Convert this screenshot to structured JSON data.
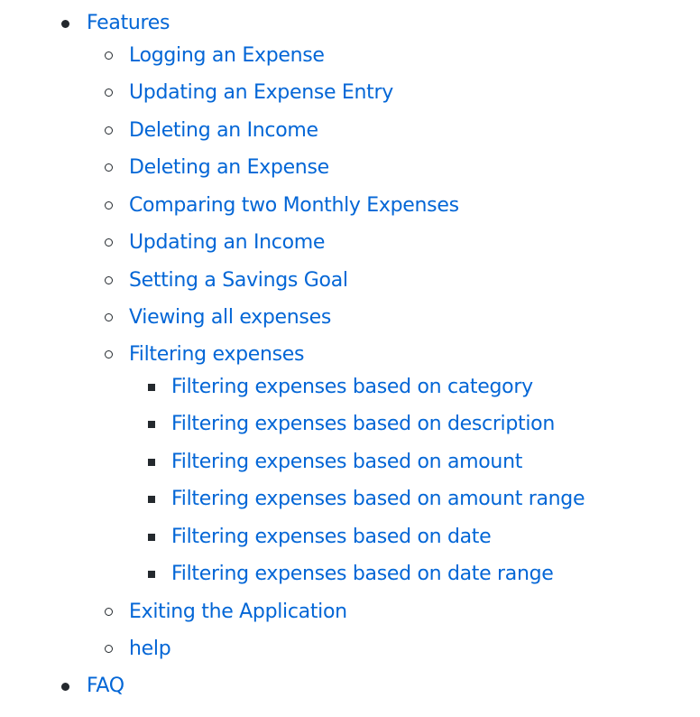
{
  "toc": {
    "features": "Features",
    "logging_expense": "Logging an Expense",
    "updating_expense_entry": "Updating an Expense Entry",
    "deleting_income": "Deleting an Income",
    "deleting_expense": "Deleting an Expense",
    "comparing_monthly": "Comparing two Monthly Expenses",
    "updating_income": "Updating an Income",
    "savings_goal": "Setting a Savings Goal",
    "viewing_expenses": "Viewing all expenses",
    "filtering_expenses": "Filtering expenses",
    "filter_category": "Filtering expenses based on category",
    "filter_description": "Filtering expenses based on description",
    "filter_amount": "Filtering expenses based on amount",
    "filter_amount_range": "Filtering expenses based on amount range",
    "filter_date": "Filtering expenses based on date",
    "filter_date_range": "Filtering expenses based on date range",
    "exiting": "Exiting the Application",
    "help": "help",
    "faq": "FAQ"
  }
}
